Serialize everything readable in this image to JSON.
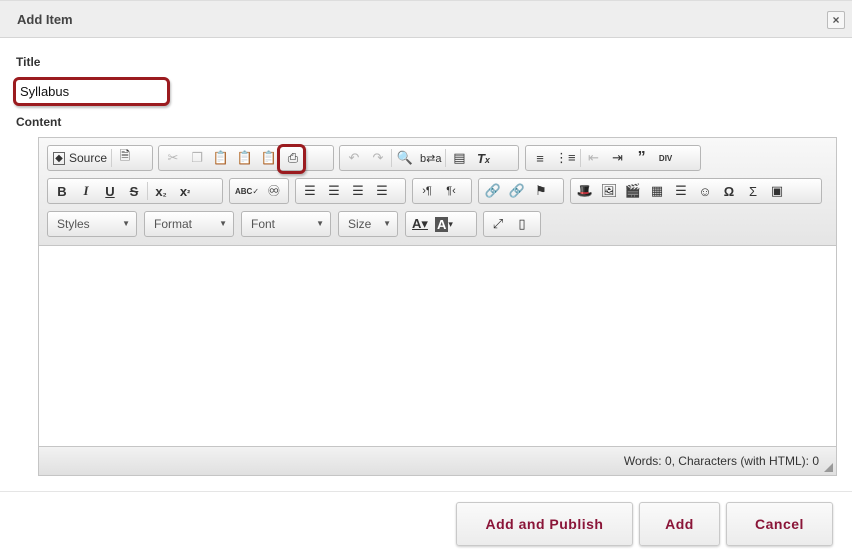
{
  "dialog": {
    "title": "Add Item",
    "close_label": "×"
  },
  "form": {
    "title_label": "Title",
    "title_value": "Syllabus",
    "content_label": "Content"
  },
  "toolbar": {
    "source_label": "Source",
    "styles_label": "Styles",
    "format_label": "Format",
    "font_label": "Font",
    "size_label": "Size",
    "highlighted_button": "paste-from-word-icon"
  },
  "editor": {
    "body_text": "",
    "status": "Words: 0, Characters (with HTML): 0"
  },
  "actions": {
    "add_and_publish": "Add and Publish",
    "add": "Add",
    "cancel": "Cancel"
  },
  "colors": {
    "accent": "#8a1538",
    "highlight_border": "#9b1b1f"
  }
}
